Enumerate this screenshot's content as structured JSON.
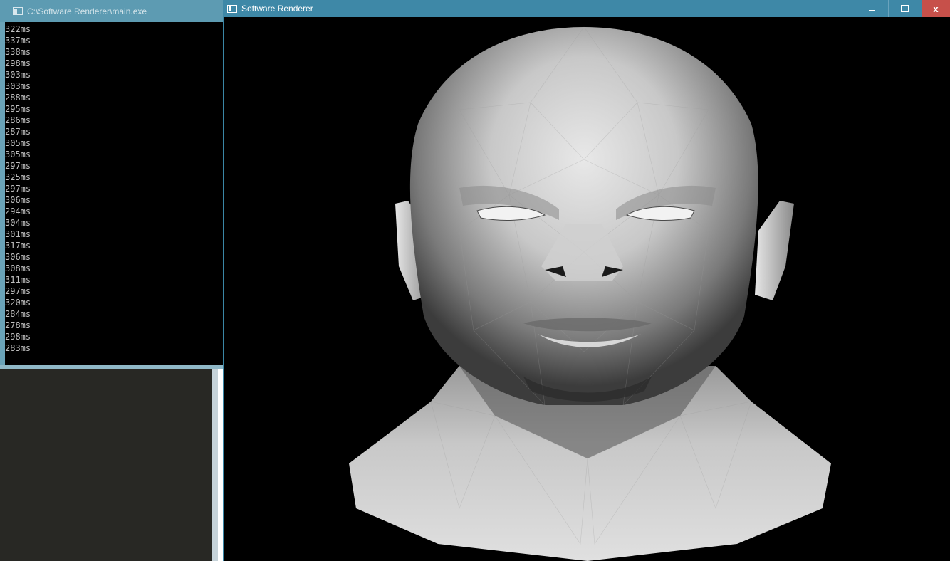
{
  "console": {
    "title": "C:\\Software Renderer\\main.exe",
    "lines": [
      "322ms",
      "337ms",
      "338ms",
      "298ms",
      "303ms",
      "303ms",
      "288ms",
      "295ms",
      "286ms",
      "287ms",
      "305ms",
      "305ms",
      "297ms",
      "325ms",
      "297ms",
      "306ms",
      "294ms",
      "304ms",
      "301ms",
      "317ms",
      "306ms",
      "308ms",
      "311ms",
      "297ms",
      "320ms",
      "284ms",
      "278ms",
      "298ms",
      "283ms"
    ]
  },
  "renderer": {
    "title": "Software Renderer",
    "close_label": "x"
  },
  "colors": {
    "titlebar": "#3e88a7",
    "close": "#c7504a",
    "console_text": "#c0c0c0"
  }
}
